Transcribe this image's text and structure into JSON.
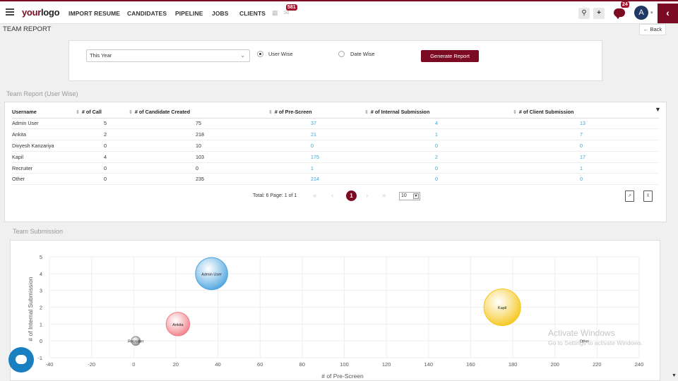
{
  "brand": {
    "logo_your": "your",
    "logo_logo": "logo"
  },
  "nav": {
    "items": [
      "IMPORT RESUME",
      "CANDIDATES",
      "PIPELINE",
      "JOBS",
      "CLIENTS"
    ],
    "calendar_icon": "calendar-icon",
    "mail_icon": "mail-icon",
    "mail_badge": "581",
    "chat_badge": "24",
    "avatar_initial": "A",
    "search_icon": "search-icon",
    "plus_icon": "plus-icon"
  },
  "page": {
    "title": "TEAM REPORT",
    "back_label": "Back"
  },
  "filters": {
    "period": "This Year",
    "user_wise": "User Wise",
    "date_wise": "Date Wise",
    "selected": "User Wise",
    "generate": "Generate Report"
  },
  "report": {
    "section_title": "Team Report (User Wise)",
    "columns": [
      "Username",
      "# of Call",
      "# of Candidate Created",
      "# of Pre-Screen",
      "# of Internal Submission",
      "# of Client Submission"
    ],
    "rows": [
      [
        "Admin User",
        "5",
        "75",
        "37",
        "4",
        "13"
      ],
      [
        "Ankita",
        "2",
        "218",
        "21",
        "1",
        "7"
      ],
      [
        "Divyesh Kanzariya",
        "0",
        "10",
        "0",
        "0",
        "0"
      ],
      [
        "Kapil",
        "4",
        "103",
        "175",
        "2",
        "17"
      ],
      [
        "Recruiter",
        "0",
        "0",
        "1",
        "0",
        "1"
      ],
      [
        "Other",
        "0",
        "235",
        "214",
        "0",
        "0"
      ]
    ],
    "pager_text": "Total: 6 Page: 1 of 1",
    "current_page": "1",
    "page_size": "10",
    "pdf_icon": "pdf-icon",
    "excel_icon": "excel-icon"
  },
  "submission": {
    "section_title": "Team Submission"
  },
  "chart_data": {
    "type": "scatter",
    "title": "",
    "xlabel": "# of Pre-Screen",
    "ylabel": "# of Internal Submission",
    "xlim": [
      -40,
      240
    ],
    "ylim": [
      -1,
      5
    ],
    "xticks": [
      -40,
      -20,
      0,
      20,
      40,
      60,
      80,
      100,
      120,
      140,
      160,
      180,
      200,
      220,
      240
    ],
    "yticks": [
      -1,
      0,
      1,
      2,
      3,
      4,
      5
    ],
    "grid": true,
    "points": [
      {
        "label": "Admin User",
        "x": 37,
        "y": 4,
        "size": 13,
        "color": "#4aa3df"
      },
      {
        "label": "Ankita",
        "x": 21,
        "y": 1,
        "size": 7,
        "color": "#f07c84"
      },
      {
        "label": "Kapil",
        "x": 175,
        "y": 2,
        "size": 17,
        "color": "#f5c518"
      },
      {
        "label": "Recruiter",
        "x": 1,
        "y": 0,
        "size": 1,
        "color": "#888888"
      },
      {
        "label": "Other",
        "x": 214,
        "y": 0,
        "size": 0,
        "color": "#888888"
      }
    ]
  },
  "watermark": {
    "line1": "Activate Windows",
    "line2": "Go to Settings to activate Windows."
  }
}
